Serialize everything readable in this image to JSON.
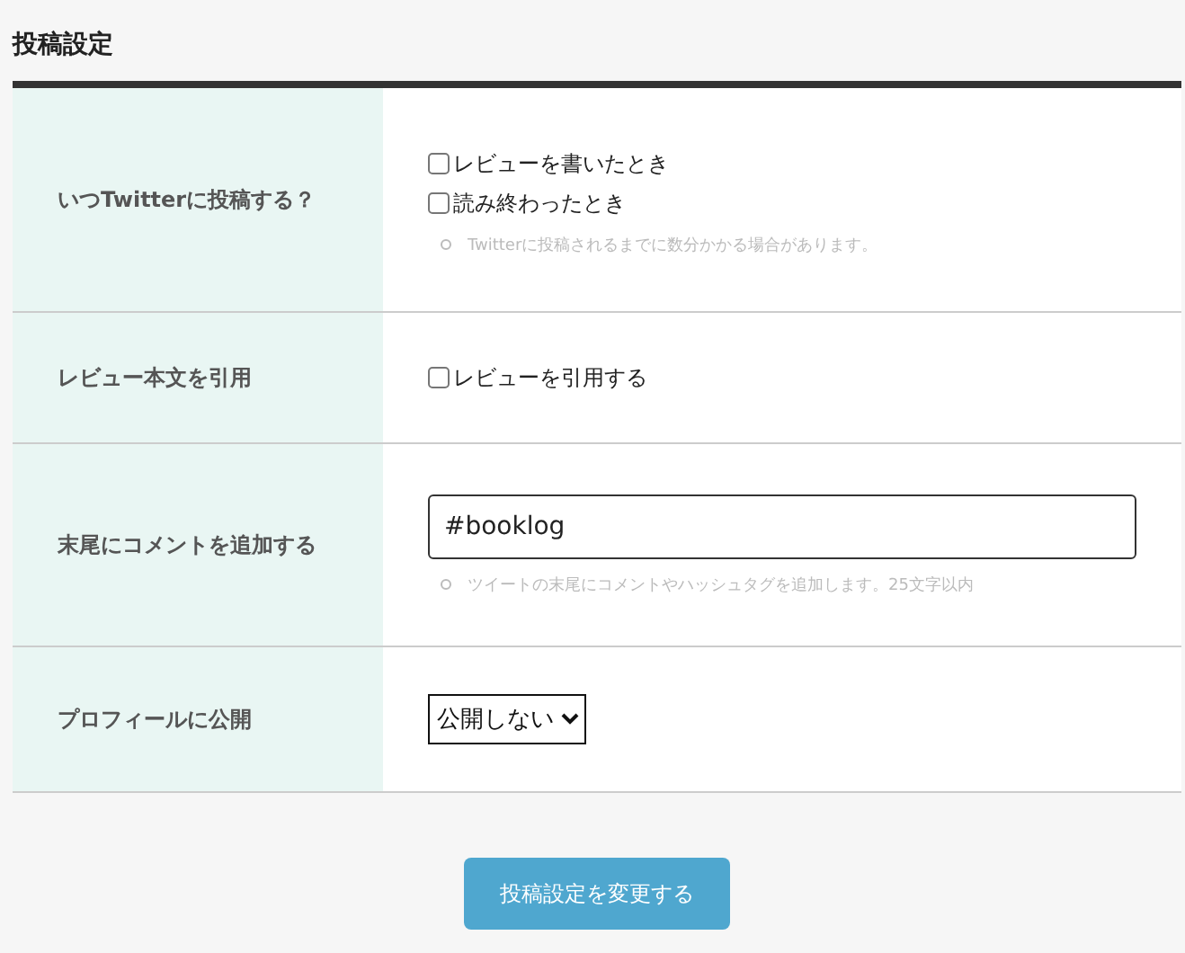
{
  "title": "投稿設定",
  "rows": [
    {
      "label": "いつTwitterに投稿する？",
      "kind": "checkboxes",
      "options": [
        {
          "label": "レビューを書いたとき",
          "checked": false
        },
        {
          "label": "読み終わったとき",
          "checked": false
        }
      ],
      "note": "Twitterに投稿されるまでに数分かかる場合があります。"
    },
    {
      "label": "レビュー本文を引用",
      "kind": "checkboxes",
      "options": [
        {
          "label": "レビューを引用する",
          "checked": false
        }
      ]
    },
    {
      "label": "末尾にコメントを追加する",
      "kind": "text",
      "value": "#booklog",
      "note": "ツイートの末尾にコメントやハッシュタグを追加します。25文字以内"
    },
    {
      "label": "プロフィールに公開",
      "kind": "select",
      "value": "公開しない"
    }
  ],
  "submit": "投稿設定を変更する"
}
